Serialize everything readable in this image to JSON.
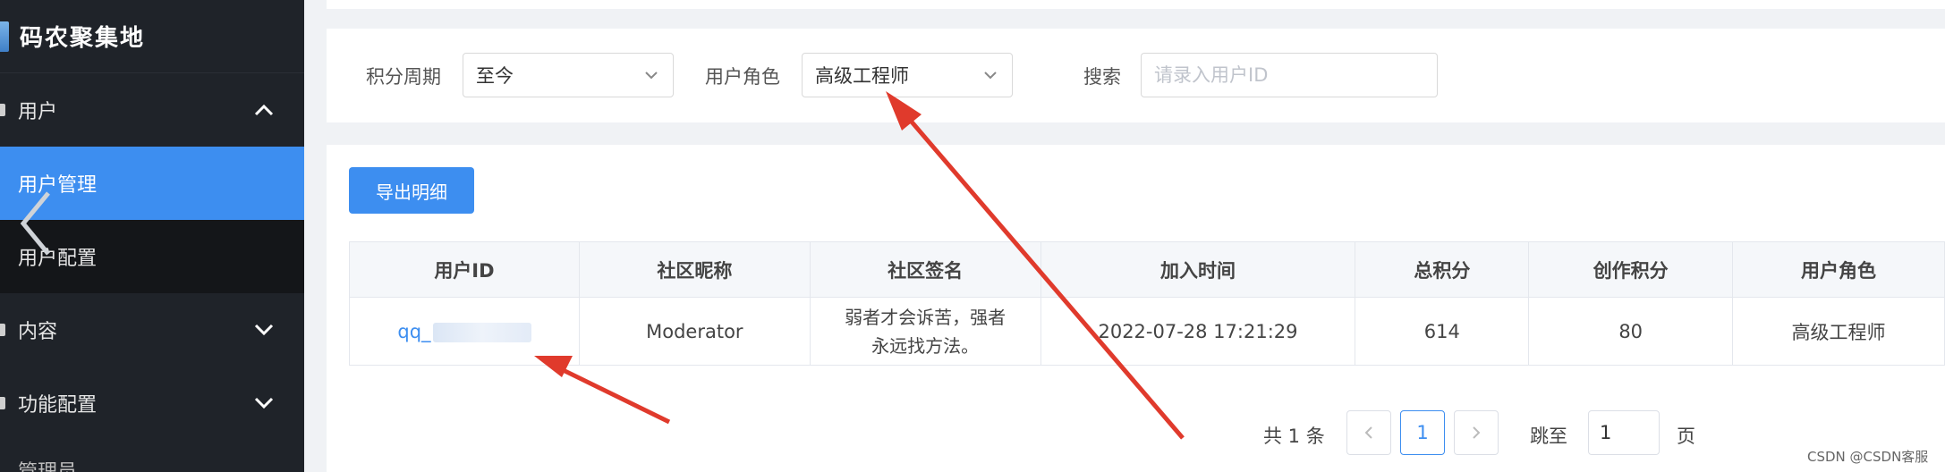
{
  "sidebar": {
    "brand": "码农聚集地",
    "groups": [
      {
        "label": "用户"
      },
      {
        "label": "内容"
      },
      {
        "label": "功能配置"
      }
    ],
    "sub_items": [
      {
        "label": "用户管理"
      },
      {
        "label": "用户配置"
      }
    ],
    "cut_item": "管理员"
  },
  "filters": {
    "period_label": "积分周期",
    "period_value": "至今",
    "role_label": "用户角色",
    "role_value": "高级工程师",
    "search_label": "搜索",
    "search_placeholder": "请录入用户ID"
  },
  "toolbar": {
    "export_label": "导出明细"
  },
  "table": {
    "columns": [
      "用户ID",
      "社区昵称",
      "社区签名",
      "加入时间",
      "总积分",
      "创作积分",
      "用户角色"
    ],
    "rows": [
      {
        "uid": "qq_",
        "nickname": "Moderator",
        "signature_line1": "弱者才会诉苦，强者",
        "signature_line2": "永远找方法。",
        "joined": "2022-07-28 17:21:29",
        "total_points": "614",
        "creation_points": "80",
        "role": "高级工程师"
      }
    ]
  },
  "pagination": {
    "total_text": "共 1 条",
    "current_page": "1",
    "goto_label": "跳至",
    "goto_value": "1",
    "page_suffix": "页"
  },
  "watermark": "CSDN @CSDN客服",
  "colors": {
    "accent": "#3d8ef0",
    "sidebar_bg": "#1f2329",
    "arrow": "#e03a2c"
  }
}
